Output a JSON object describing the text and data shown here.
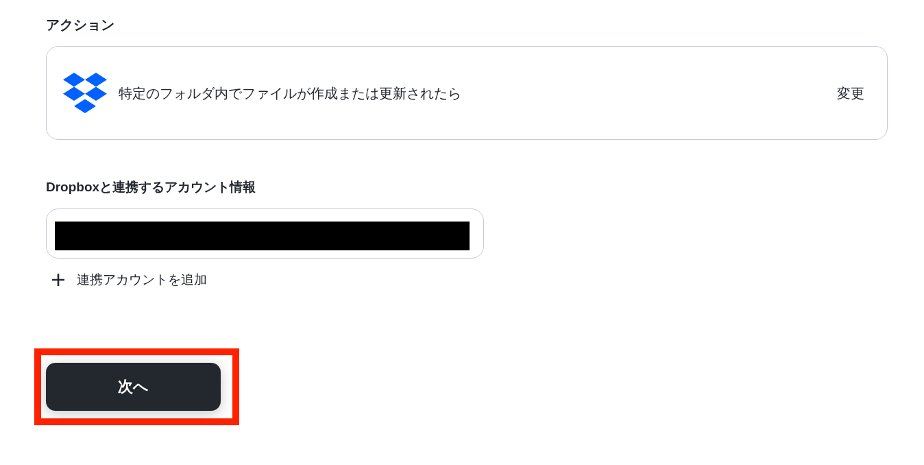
{
  "section": {
    "title": "アクション"
  },
  "action_card": {
    "text": "特定のフォルダ内でファイルが作成または更新されたら",
    "change_link": "変更"
  },
  "account": {
    "label": "Dropboxと連携するアカウント情報",
    "field": {
      "redacted": true
    },
    "add_link": "連携アカウントを追加"
  },
  "next_button": {
    "label": "次へ",
    "highlighted": true
  }
}
